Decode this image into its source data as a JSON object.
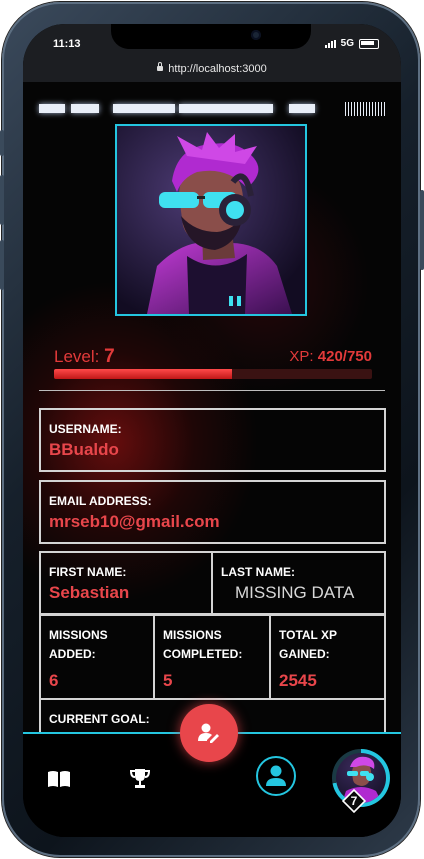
{
  "status_bar": {
    "time": "11:13",
    "network": "5G"
  },
  "browser": {
    "url": "http://localhost:3000"
  },
  "profile": {
    "level_label": "Level:",
    "level": "7",
    "xp_label": "XP:",
    "xp_text": "420/750",
    "xp_progress": 0.56
  },
  "fields": {
    "username_label": "USERNAME:",
    "username": "BBualdo",
    "email_label": "EMAIL ADDRESS:",
    "email": "mrseb10@gmail.com",
    "first_name_label": "FIRST NAME:",
    "first_name": "Sebastian",
    "last_name_label": "LAST NAME:",
    "last_name": "MISSING DATA",
    "missions_added_label_1": "MISSIONS",
    "missions_added_label_2": "ADDED:",
    "missions_added": "6",
    "missions_completed_label_1": "MISSIONS",
    "missions_completed_label_2": "COMPLETED:",
    "missions_completed": "5",
    "total_xp_label_1": "TOTAL XP",
    "total_xp_label_2": "GAINED:",
    "total_xp": "2545",
    "current_goal_label": "CURRENT GOAL:"
  },
  "nav": {
    "badge_level": "7",
    "avatar_progress": 0.72
  },
  "colors": {
    "accent_red": "#e8464b",
    "accent_cyan": "#24c6e0",
    "background": "#050505"
  },
  "icons": [
    "lock-icon",
    "book-icon",
    "trophy-icon",
    "edit-user-icon",
    "user-icon",
    "level-badge-icon"
  ]
}
